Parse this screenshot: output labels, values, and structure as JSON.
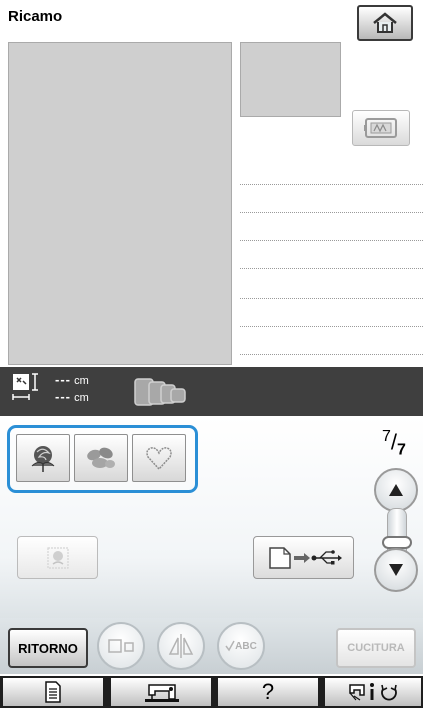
{
  "header": {
    "title": "Ricamo",
    "home_icon": "home-icon"
  },
  "preview": {
    "frame_button_icon": "embroidery-frame-icon"
  },
  "size": {
    "height_value": "---",
    "height_unit": "cm",
    "width_value": "---",
    "width_unit": "cm",
    "icons": [
      "size-measure-icon",
      "frame-sizes-icon"
    ]
  },
  "designs": [
    {
      "name": "rose-design",
      "icon": "rose-design-icon"
    },
    {
      "name": "leaves-design",
      "icon": "leaves-design-icon"
    },
    {
      "name": "heart-design",
      "icon": "heart-outline-design-icon"
    }
  ],
  "pagination": {
    "current": "7",
    "total": "7"
  },
  "actions": {
    "back_label": "RITORNO",
    "abc_label": "ABC",
    "sew_label": "CUCITURA"
  },
  "footer": {
    "help_label": "?"
  },
  "colors": {
    "highlight": "#2b8fd6",
    "size_bar": "#3f3f3f",
    "footer": "#1e1e1e",
    "preview": "#cfcfcf"
  }
}
